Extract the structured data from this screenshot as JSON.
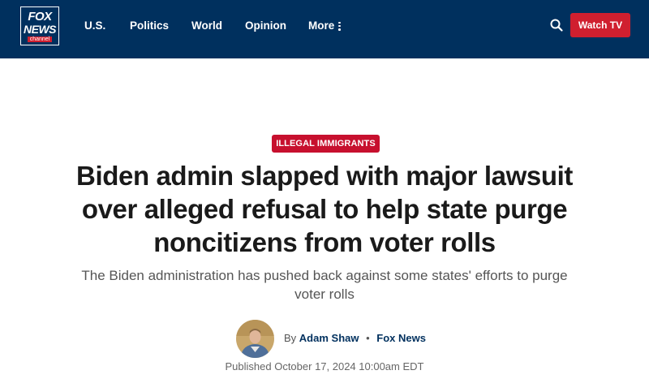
{
  "header": {
    "logo": {
      "line1": "FOX",
      "line2": "NEWS",
      "line3": "channel"
    },
    "nav": [
      {
        "label": "U.S."
      },
      {
        "label": "Politics"
      },
      {
        "label": "World"
      },
      {
        "label": "Opinion"
      },
      {
        "label": "More"
      }
    ],
    "search_icon": "search-icon",
    "watch_tv_label": "Watch TV",
    "colors": {
      "background": "#00305e",
      "accent": "#d01f2f"
    }
  },
  "article": {
    "category": "ILLEGAL IMMIGRANTS",
    "headline": "Biden admin slapped with major lawsuit over alleged refusal to help state purge noncitizens from voter rolls",
    "subheadline": "The Biden administration has pushed back against some states' efforts to purge voter rolls",
    "byline": {
      "prefix": "By",
      "author": "Adam Shaw",
      "separator": "•",
      "source": "Fox News"
    },
    "published": "Published October 17, 2024 10:00am EDT"
  }
}
